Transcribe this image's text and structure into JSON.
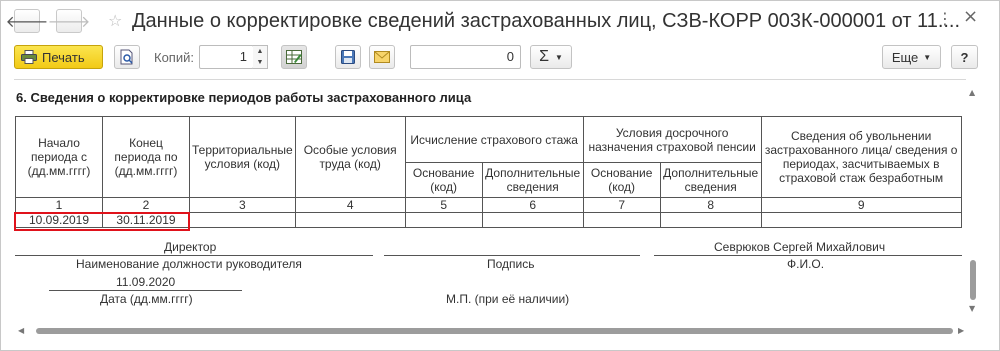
{
  "window": {
    "title": "Данные о корректировке сведений застрахованных лиц, СЗВ-КОРР 003К-000001 от 11....",
    "back_glyph": "🡐",
    "forward_glyph": "🡒",
    "star_glyph": "☆",
    "menu_glyph": "⋮",
    "close_glyph": "×"
  },
  "toolbar": {
    "print_label": "Печать",
    "copies_label": "Копий:",
    "copies_value": "1",
    "sum_value": "0",
    "sum_symbol": "Σ",
    "more_label": "Еще",
    "help_label": "?"
  },
  "document": {
    "section_title": "6. Сведения о корректировке периодов работы застрахованного лица",
    "headers": {
      "start": "Начало периода с (дд.мм.гггг)",
      "end": "Конец периода по (дд.мм.гггг)",
      "territorial": "Территориальные условия (код)",
      "special": "Особые условия труда (код)",
      "insurance": "Исчисление страхового стажа",
      "early": "Условия досрочного назначения страховой пенсии",
      "dismissal": "Сведения об увольнении застрахованного лица/ сведения о периодах, засчитываемых в страховой стаж безработным",
      "basis": "Основание (код)",
      "additional": "Дополнительные сведения"
    },
    "column_numbers": [
      "1",
      "2",
      "3",
      "4",
      "5",
      "6",
      "7",
      "8",
      "9"
    ],
    "row": {
      "start": "10.09.2019",
      "end": "30.11.2019"
    },
    "signature": {
      "position": "Директор",
      "position_caption": "Наименование должности руководителя",
      "signature_caption": "Подпись",
      "name": "Севрюков Сергей Михайлович",
      "name_caption": "Ф.И.О.",
      "date": "11.09.2020",
      "date_caption": "Дата (дд.мм.гггг)",
      "stamp_caption": "М.П. (при её наличии)"
    }
  },
  "colors": {
    "highlight_border": "#e0121b",
    "print_button": "#f2ca16"
  }
}
